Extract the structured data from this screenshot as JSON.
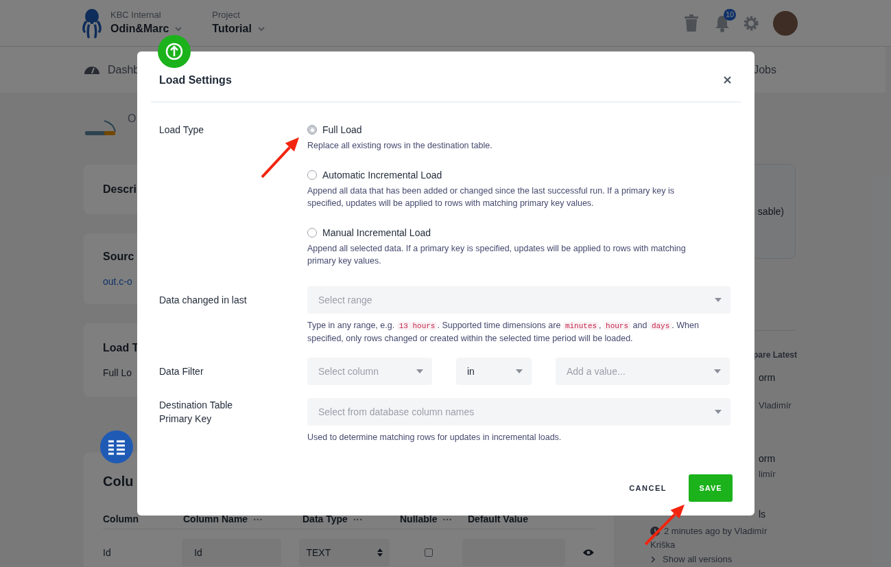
{
  "header": {
    "org_label": "KBC Internal",
    "org_name": "Odin&Marc",
    "project_label": "Project",
    "project_name": "Tutorial",
    "notification_count": "10"
  },
  "nav": [
    "Dashb",
    "Jobs"
  ],
  "page": {
    "breadcrumb": "O",
    "cards": [
      {
        "title": "Descri"
      },
      {
        "title": "Sourc",
        "value": "out.c-o"
      },
      {
        "title": "Load T",
        "value": "Full Lo"
      }
    ],
    "columns_section": {
      "title": "Colu",
      "headers": [
        {
          "label": "Column"
        },
        {
          "label": "Column Name",
          "menu": "···"
        },
        {
          "label": "Data Type",
          "menu": "···"
        },
        {
          "label": "Nullable",
          "menu": "···"
        },
        {
          "label": "Default Value"
        }
      ],
      "rows": [
        {
          "column": "Id",
          "name": "Id",
          "type": "TEXT",
          "nullable": false,
          "default": ""
        }
      ]
    }
  },
  "sidebar": {
    "card_text": "sable)",
    "versions_heading": "pare Latest",
    "versions": [
      {
        "title": "orm",
        "meta": "Vladimír"
      },
      {
        "title": "orm",
        "meta": "limír"
      },
      {
        "title": "ls",
        "meta": "2 minutes ago by Vladimír",
        "meta2": "Kriška"
      }
    ],
    "show_all": "Show all versions"
  },
  "modal": {
    "title": "Load Settings",
    "load_type": {
      "label": "Load Type",
      "options": [
        {
          "label": "Full Load",
          "description": "Replace all existing rows in the destination table.",
          "selected": true
        },
        {
          "label": "Automatic Incremental Load",
          "description": "Append all data that has been added or changed since the last successful run. If a primary key is specified, updates will be applied to rows with matching primary key values.",
          "selected": false
        },
        {
          "label": "Manual Incremental Load",
          "description": "Append all selected data. If a primary key is specified, updates will be applied to rows with matching primary key values.",
          "selected": false
        }
      ]
    },
    "data_changed": {
      "label": "Data changed in last",
      "placeholder": "Select range",
      "help": [
        {
          "kind": "text",
          "text": "Type in any range, e.g. "
        },
        {
          "kind": "code",
          "text": "13 hours"
        },
        {
          "kind": "text",
          "text": ". Supported time dimensions are "
        },
        {
          "kind": "code",
          "text": "minutes"
        },
        {
          "kind": "text",
          "text": ", "
        },
        {
          "kind": "code",
          "text": "hours"
        },
        {
          "kind": "text",
          "text": " and "
        },
        {
          "kind": "code",
          "text": "days"
        },
        {
          "kind": "text",
          "text": ". When specified, only rows changed or created within the selected time period will be loaded."
        }
      ]
    },
    "data_filter": {
      "label": "Data Filter",
      "column_placeholder": "Select column",
      "operator": "in",
      "value_placeholder": "Add a value..."
    },
    "primary_key": {
      "label": "Destination Table Primary Key",
      "placeholder": "Select from database column names",
      "help": "Used to determine matching rows for updates in incremental loads."
    },
    "cancel": "CANCEL",
    "save": "SAVE"
  }
}
